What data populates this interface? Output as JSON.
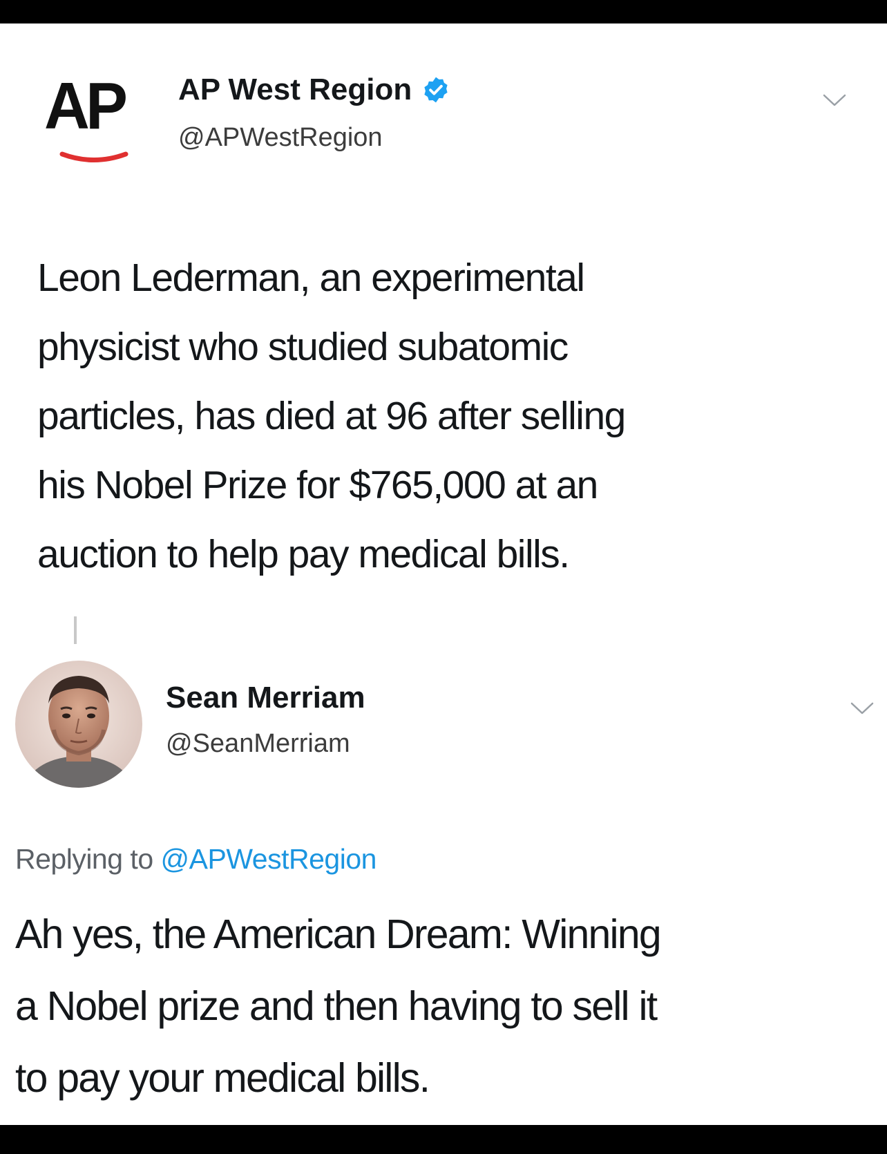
{
  "original_tweet": {
    "logo_text": "AP",
    "display_name": "AP West Region",
    "verified": true,
    "handle": "@APWestRegion",
    "text_lines": [
      "Leon Lederman, an experimental",
      "physicist who studied subatomic",
      "particles, has died at 96 after selling",
      "his Nobel Prize for $765,000 at an",
      "auction to help pay medical bills."
    ]
  },
  "reply_tweet": {
    "display_name": "Sean Merriam",
    "handle": "@SeanMerriam",
    "replying_prefix": "Replying to",
    "replying_mention": "@APWestRegion",
    "text_lines": [
      "Ah yes, the American Dream: Winning",
      "a Nobel prize and then having to sell it",
      "to pay your medical bills."
    ]
  },
  "colors": {
    "verified_badge": "#1da1f2",
    "mention": "#1b95e0",
    "ap_swoosh": "#e03030"
  },
  "icons": {
    "verified": "verified-badge-icon",
    "more": "chevron-down-icon"
  }
}
